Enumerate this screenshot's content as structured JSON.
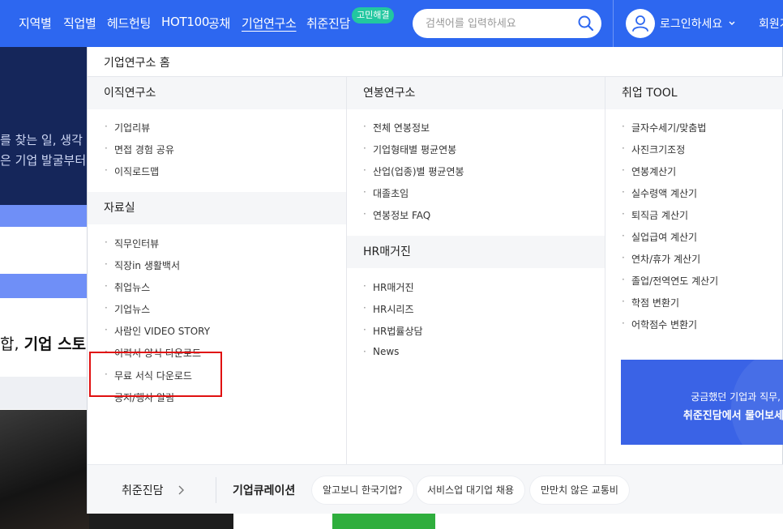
{
  "nav": {
    "items": [
      "지역별",
      "직업별",
      "헤드헌팅",
      "HOT100",
      "공채",
      "기업연구소",
      "취준진담"
    ],
    "badge": "고민해결",
    "search_placeholder": "검색어를 입력하세요",
    "login": "로그인하세요",
    "signup": "회원가"
  },
  "background": {
    "text1": "를 찾는 일, 생각",
    "text2": "은 기업 발굴부터",
    "heading_plain": "합, ",
    "heading_bold": "기업 스토"
  },
  "menu": {
    "home": "기업연구소 홈",
    "col1": {
      "title": "이직연구소",
      "items": [
        "기업리뷰",
        "면접 경험 공유",
        "이직로드맵"
      ],
      "section2_title": "자료실",
      "section2_items": [
        "직무인터뷰",
        "직장in 생활백서",
        "취업뉴스",
        "기업뉴스",
        "사람인 VIDEO STORY",
        "이력서 양식 다운로드",
        "무료 서식 다운로드",
        "공지/행사 알림"
      ]
    },
    "col2": {
      "title": "연봉연구소",
      "items": [
        "전체 연봉정보",
        "기업형태별 평균연봉",
        "산업(업종)별 평균연봉",
        "대졸초임",
        "연봉정보 FAQ"
      ],
      "section2_title": "HR매거진",
      "section2_items": [
        "HR매거진",
        "HR시리즈",
        "HR법률상담",
        "News"
      ]
    },
    "col3": {
      "title": "취업 TOOL",
      "items": [
        "글자수세기/맞춤법",
        "사진크기조정",
        "연봉계산기",
        "실수령액 계산기",
        "퇴직금 계산기",
        "실업급여 계산기",
        "연차/휴가 계산기",
        "졸업/전역연도 계산기",
        "학점 변환기",
        "어학점수 변환기"
      ],
      "promo_line1": "궁금했던 기업과 직무,",
      "promo_line2": "취준진담에서 물어보세"
    },
    "bottom": {
      "label": "취준진담",
      "curation": "기업큐레이션",
      "chips": [
        "알고보니 한국기업?",
        "서비스업 대기업 채용",
        "만만치 않은 교통비"
      ]
    }
  },
  "colors": {
    "nav_bg": "#2d67f0",
    "badge": "#22c7a0",
    "highlight": "#e01010"
  }
}
